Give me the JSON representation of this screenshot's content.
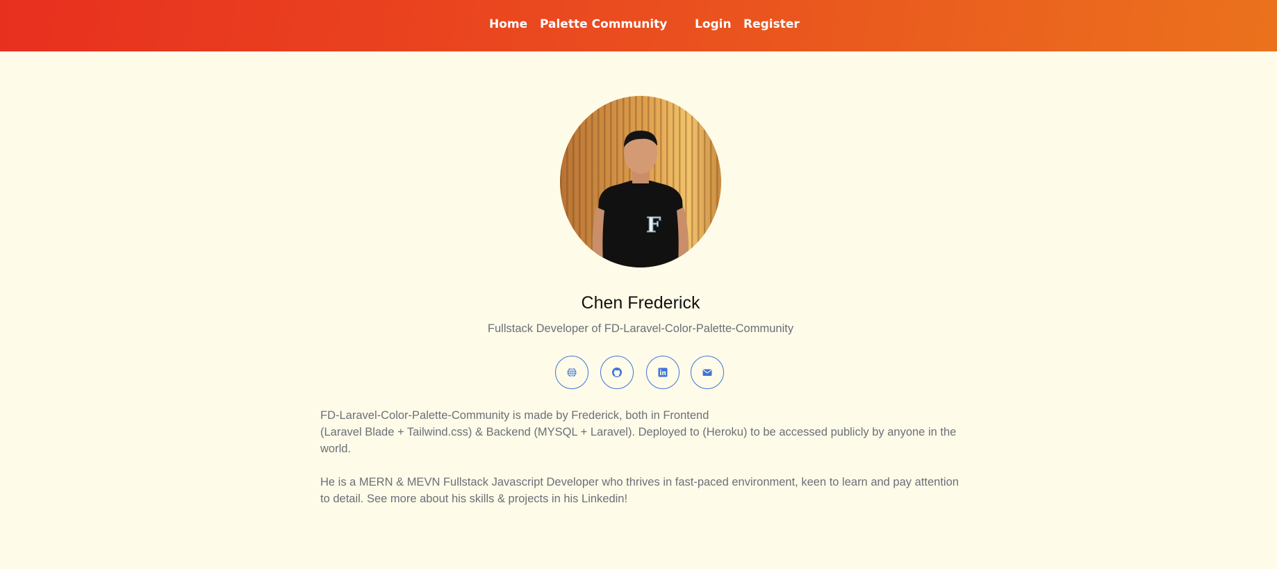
{
  "nav": {
    "home": "Home",
    "palette_community": "Palette Community",
    "login": "Login",
    "register": "Register"
  },
  "profile": {
    "name": "Chen Frederick",
    "role": "Fullstack Developer of FD-Laravel-Color-Palette-Community"
  },
  "social_icons": [
    "globe-icon",
    "github-icon",
    "linkedin-icon",
    "mail-icon"
  ],
  "about": {
    "line1": "FD-Laravel-Color-Palette-Community is made by Frederick, both in Frontend",
    "line2": "(Laravel Blade + Tailwind.css) & Backend (MYSQL + Laravel). Deployed to (Heroku) to be accessed publicly by anyone in the world.",
    "paragraph2": "He is a MERN & MEVN Fullstack Javascript Developer who thrives in fast-paced environment, keen to learn and pay attention to detail. See more about his skills & projects in his Linkedin!"
  },
  "colors": {
    "header_gradient_start": "#e8301f",
    "header_gradient_end": "#eb721d",
    "background": "#fffbe9",
    "accent": "#3c74d8",
    "text_muted": "#6b6f76"
  }
}
